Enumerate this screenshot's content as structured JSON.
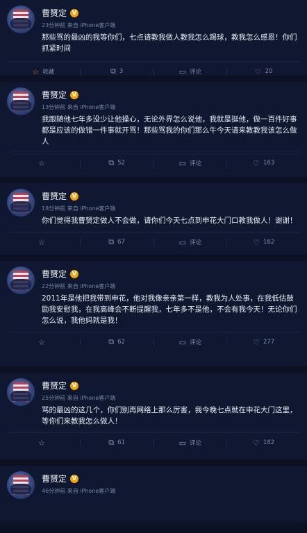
{
  "posts": [
    {
      "name": "曹赟定",
      "badge": "V",
      "time": "23分钟前",
      "source": "来自 iPhone客户端",
      "text": "那些骂的最凶的我等你们，七点请教我做人教我怎么踢球，教我怎么感恩！你们抓紧时间",
      "fav_label": "收藏",
      "repost": "3",
      "comment": "评论",
      "like": "20"
    },
    {
      "name": "曹赟定",
      "badge": "V",
      "time": "13分钟前",
      "source": "来自 iPhone客户端",
      "text": "我跟随他七年多没少让他操心，无论外界怎么说他，我就是挺他，做一百件好事都是应该的做错一件事就开骂！那些骂我的你们那么牛今天请来教教我该怎么做人",
      "fav_label": "",
      "repost": "52",
      "comment": "评论",
      "like": "163"
    },
    {
      "name": "曹赟定",
      "badge": "V",
      "time": "18分钟前",
      "source": "来自 iPhone客户端",
      "text": "你们觉得我曹赟定做人不会做，请你们今天七点到申花大门口教我做人！谢谢！",
      "fav_label": "",
      "repost": "67",
      "comment": "评论",
      "like": "162"
    },
    {
      "name": "曹赟定",
      "badge": "V",
      "time": "22分钟前",
      "source": "来自 iPhone客户端",
      "text": "2011年是他把我带到申花，他对我像亲亲第一样，教我为人处事，在我低估鼓励我安慰我，在我高峰会不断提醒我，七年多不是他，不会有我今天！无论你们怎么说，我他妈就是我！",
      "fav_label": "",
      "repost": "62",
      "comment": "评论",
      "like": "277"
    },
    {
      "name": "曹赟定",
      "badge": "V",
      "time": "25分钟前",
      "source": "来自 iPhone客户端",
      "text": "骂的最凶的这几个，你们别再网络上那么厉害，我今晚七点就在申花大门这里，等你们来教我怎么做人！",
      "fav_label": "",
      "repost": "61",
      "comment": "评论",
      "like": "182"
    },
    {
      "name": "曹赟定",
      "badge": "V",
      "time": "46分钟前",
      "source": "来自 iPhone客户端",
      "text": "",
      "fav_label": "",
      "repost": "",
      "comment": "",
      "like": ""
    }
  ],
  "icons": {
    "star": "star-icon",
    "repost": "repost-icon",
    "comment": "comment-icon",
    "like": "like-icon"
  },
  "colors": {
    "background": "#0b1122",
    "card": "#0f1830",
    "verified": "#f2a20c",
    "favorite": "#d08a2a"
  }
}
